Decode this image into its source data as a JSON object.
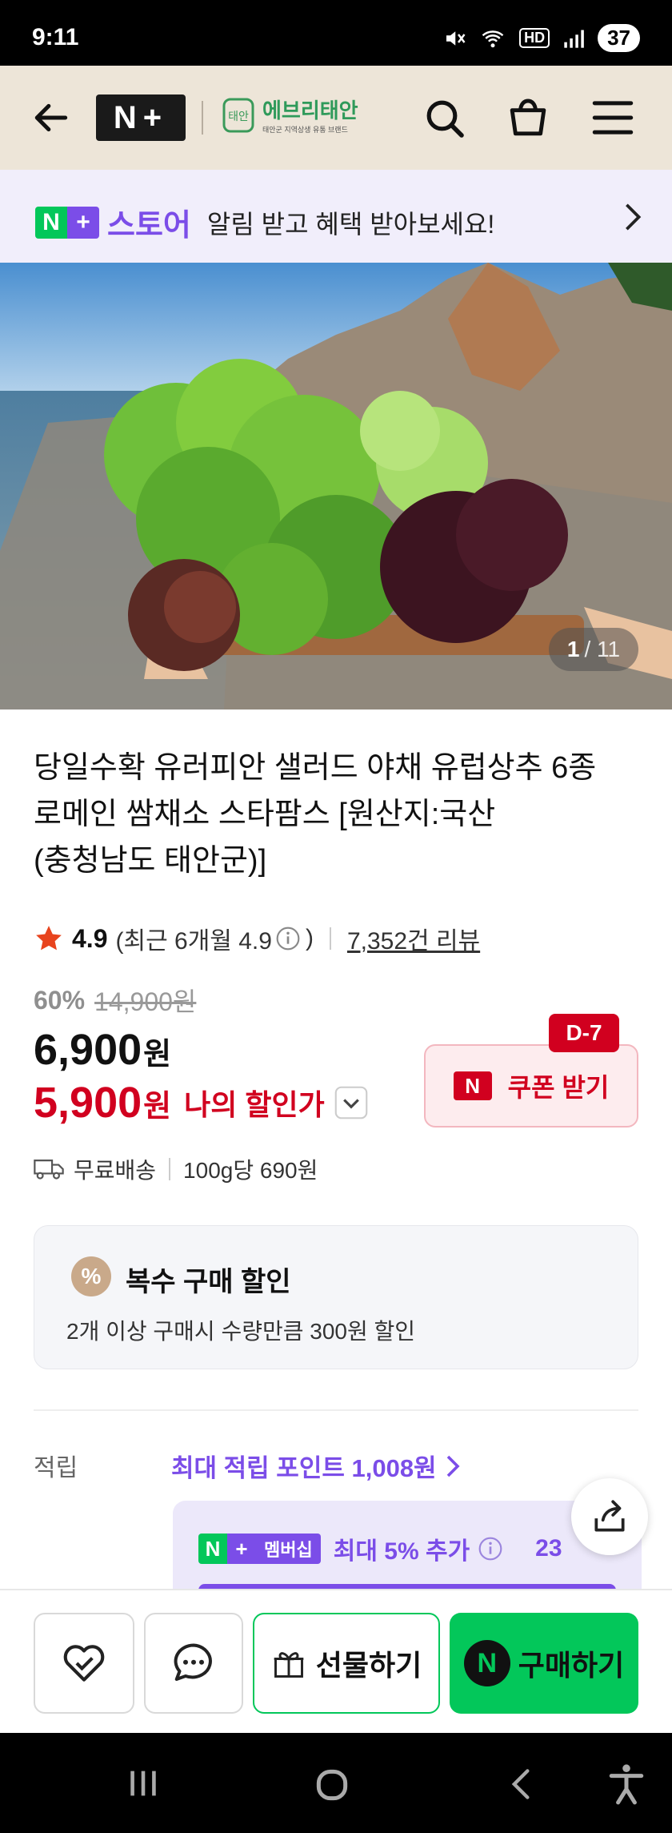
{
  "status_bar": {
    "time": "9:11",
    "network_label": "HD",
    "battery": "37"
  },
  "header": {
    "logo_text": "N+",
    "store_brand": "에브리태안",
    "store_sub": "태안군 지역상생 유통 브랜드"
  },
  "promo": {
    "badge": "N+",
    "store_label": "스토어",
    "text": "알림 받고 혜택 받아보세요!"
  },
  "image": {
    "counter_current": "1",
    "counter_total": "/ 11"
  },
  "product": {
    "title_line1": "당일수확 유러피안 샐러드 야채 유럽상추 6종",
    "title_line2": "로메인 쌈채소 스타팜스 [원산지:국산",
    "title_line3": "(충청남도 태안군)]",
    "rating": "4.9",
    "rating_recent": "(최근 6개월 4.9",
    "rating_close": ")",
    "review_count": "7,352건 리뷰",
    "discount_rate": "60%",
    "original_price": "14,900원",
    "price": "6,900",
    "price_unit": "원",
    "my_price": "5,900",
    "my_price_unit": "원",
    "my_price_label": "나의 할인가"
  },
  "coupon": {
    "dday": "D-7",
    "label": "쿠폰 받기"
  },
  "shipping": {
    "label": "무료배송",
    "unit_price": "100g당 690원"
  },
  "multi_discount": {
    "icon": "%",
    "title": "복수 구매 할인",
    "desc": "2개 이상 구매시 수량만큼 300원 할인"
  },
  "points": {
    "label": "적립",
    "max_label": "최대 적립 포인트 1,008원",
    "membership_badge": "멤버십",
    "membership_text": "최대 5% 추가",
    "membership_value": "23"
  },
  "actions": {
    "gift_label": "선물하기",
    "buy_label": "구매하기"
  },
  "colors": {
    "naver_green": "#03c75a",
    "naver_purple": "#7b4de8",
    "price_red": "#d1001f",
    "header_bg": "#ede5d8"
  }
}
